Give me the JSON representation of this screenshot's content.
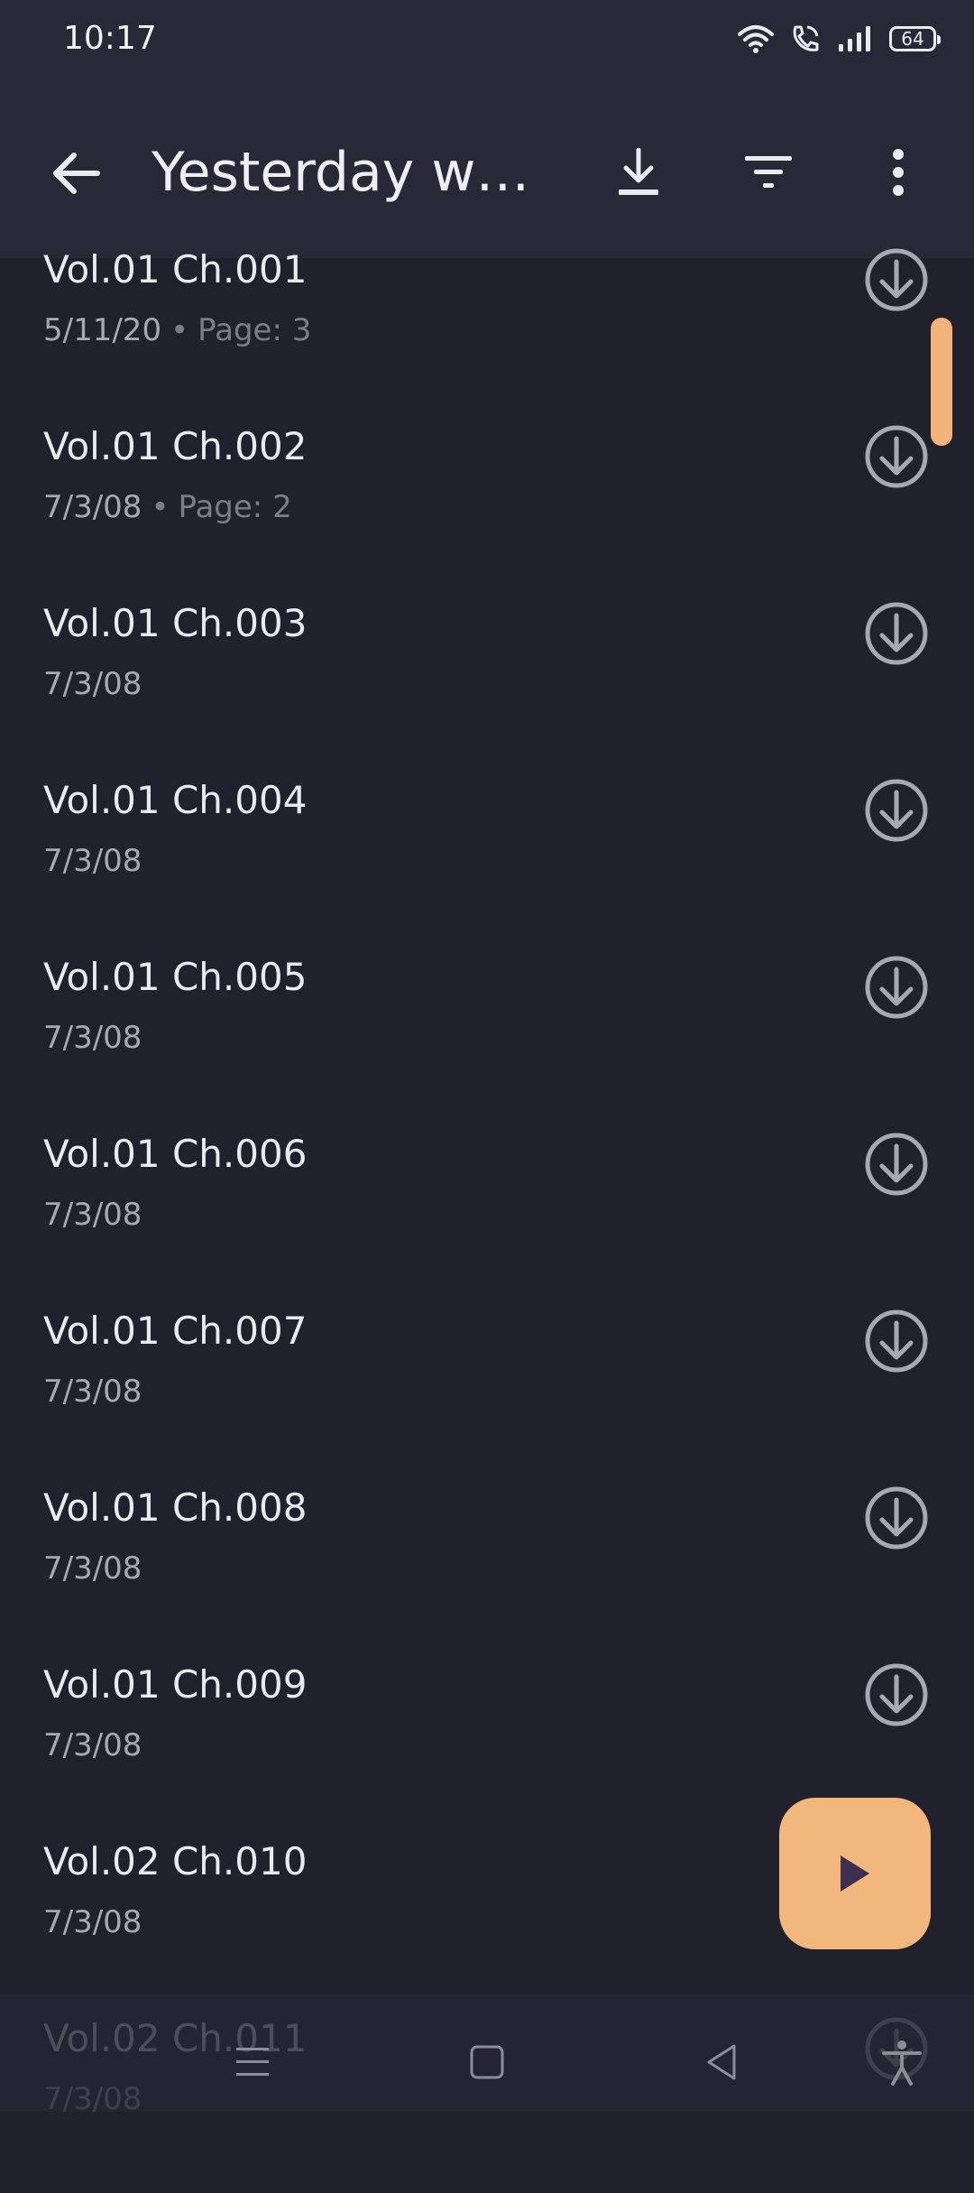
{
  "status_bar": {
    "time": "10:17",
    "battery": "64",
    "icons": [
      "wifi-icon",
      "wifi-calling-icon",
      "signal-icon",
      "battery-icon"
    ]
  },
  "app_bar": {
    "title": "Yesterday w…",
    "actions": [
      "download-icon",
      "filter-icon",
      "more-vert-icon"
    ]
  },
  "chapters": [
    {
      "title": "Vol.01 Ch.001",
      "date": "5/11/20",
      "page": "Page: 3"
    },
    {
      "title": "Vol.01 Ch.002",
      "date": "7/3/08",
      "page": "Page: 2"
    },
    {
      "title": "Vol.01 Ch.003",
      "date": "7/3/08"
    },
    {
      "title": "Vol.01 Ch.004",
      "date": "7/3/08"
    },
    {
      "title": "Vol.01 Ch.005",
      "date": "7/3/08"
    },
    {
      "title": "Vol.01 Ch.006",
      "date": "7/3/08"
    },
    {
      "title": "Vol.01 Ch.007",
      "date": "7/3/08"
    },
    {
      "title": "Vol.01 Ch.008",
      "date": "7/3/08"
    },
    {
      "title": "Vol.01 Ch.009",
      "date": "7/3/08"
    },
    {
      "title": "Vol.02 Ch.010",
      "date": "7/3/08"
    },
    {
      "title": "Vol.02 Ch.011",
      "date": "7/3/08"
    }
  ],
  "colors": {
    "background": "#21212d",
    "app_bar": "#282837",
    "accent": "#f2b77c",
    "muted_text": "#a9a7b2"
  },
  "fab": {
    "icon": "play-icon"
  },
  "nav_bar": {
    "icons": [
      "menu-nav-icon",
      "home-square-icon",
      "back-triangle-icon",
      "accessibility-icon"
    ]
  }
}
